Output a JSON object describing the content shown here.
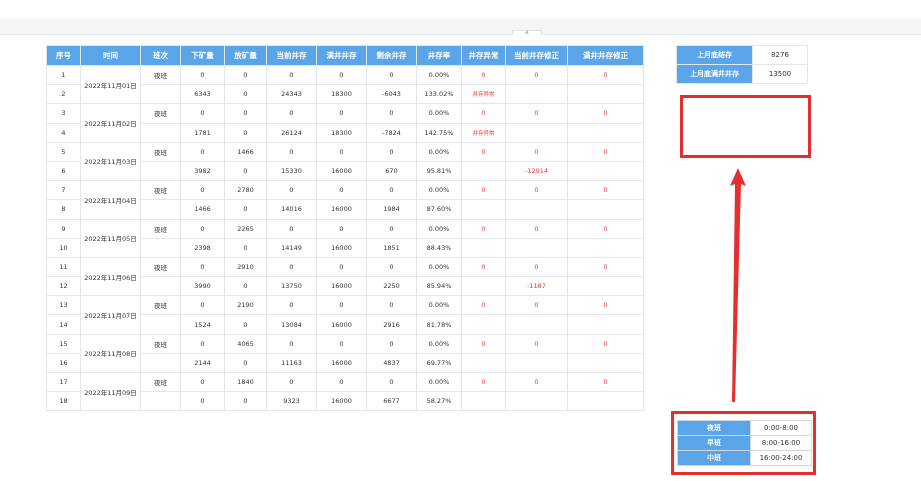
{
  "headers": [
    "序号",
    "时间",
    "班次",
    "下矿量",
    "放矿量",
    "当前井存",
    "满井井存",
    "剩余井存",
    "井存率",
    "井存异常",
    "当前井存修正",
    "满井井存修正"
  ],
  "days": [
    {
      "date": "2022年11月01日",
      "rows": [
        [
          "1",
          "夜班",
          "0",
          "0",
          "0",
          "0",
          "0",
          "0.00%",
          "0",
          "0",
          "0"
        ],
        [
          "2",
          "",
          "6343",
          "0",
          "24343",
          "18300",
          "-6043",
          "133.02%",
          "井存异常",
          "",
          ""
        ]
      ]
    },
    {
      "date": "2022年11月02日",
      "rows": [
        [
          "3",
          "夜班",
          "0",
          "0",
          "0",
          "0",
          "0",
          "0.00%",
          "0",
          "0",
          "0"
        ],
        [
          "4",
          "",
          "1781",
          "0",
          "26124",
          "18300",
          "-7824",
          "142.75%",
          "井存异常",
          "",
          ""
        ]
      ]
    },
    {
      "date": "2022年11月03日",
      "rows": [
        [
          "5",
          "夜班",
          "0",
          "1466",
          "0",
          "0",
          "0",
          "0.00%",
          "0",
          "0",
          "0"
        ],
        [
          "6",
          "",
          "3982",
          "0",
          "15330",
          "16000",
          "670",
          "95.81%",
          "",
          "-12914",
          ""
        ]
      ]
    },
    {
      "date": "2022年11月04日",
      "rows": [
        [
          "7",
          "夜班",
          "0",
          "2780",
          "0",
          "0",
          "0",
          "0.00%",
          "0",
          "0",
          "0"
        ],
        [
          "8",
          "",
          "1466",
          "0",
          "14016",
          "16000",
          "1984",
          "87.60%",
          "",
          "",
          ""
        ]
      ]
    },
    {
      "date": "2022年11月05日",
      "rows": [
        [
          "9",
          "夜班",
          "0",
          "2265",
          "0",
          "0",
          "0",
          "0.00%",
          "0",
          "0",
          "0"
        ],
        [
          "10",
          "",
          "2398",
          "0",
          "14149",
          "16000",
          "1851",
          "88.43%",
          "",
          "",
          ""
        ]
      ]
    },
    {
      "date": "2022年11月06日",
      "rows": [
        [
          "11",
          "夜班",
          "0",
          "2910",
          "0",
          "0",
          "0",
          "0.00%",
          "0",
          "0",
          "0"
        ],
        [
          "12",
          "",
          "3990",
          "0",
          "13750",
          "16000",
          "2250",
          "85.94%",
          "",
          "-1187",
          ""
        ]
      ]
    },
    {
      "date": "2022年11月07日",
      "rows": [
        [
          "13",
          "夜班",
          "0",
          "2190",
          "0",
          "0",
          "0",
          "0.00%",
          "0",
          "0",
          "0"
        ],
        [
          "14",
          "",
          "1524",
          "0",
          "13084",
          "16000",
          "2916",
          "81.78%",
          "",
          "",
          ""
        ]
      ]
    },
    {
      "date": "2022年11月08日",
      "rows": [
        [
          "15",
          "夜班",
          "0",
          "4065",
          "0",
          "0",
          "0",
          "0.00%",
          "0",
          "0",
          "0"
        ],
        [
          "16",
          "",
          "2144",
          "0",
          "11163",
          "16000",
          "4837",
          "69.77%",
          "",
          "",
          ""
        ]
      ]
    },
    {
      "date": "2022年11月09日",
      "rows": [
        [
          "17",
          "夜班",
          "0",
          "1840",
          "0",
          "0",
          "0",
          "0.00%",
          "0",
          "0",
          "0"
        ],
        [
          "18",
          "",
          "0",
          "0",
          "9323",
          "16000",
          "6677",
          "58.27%",
          "",
          "",
          ""
        ]
      ]
    }
  ],
  "stock": {
    "last_month_end_label": "上月底结存",
    "last_month_end_value": "8276",
    "last_month_full_label": "上月底满井井存",
    "last_month_full_value": "13500"
  },
  "shifts": [
    {
      "name": "夜班",
      "time": "0:00-8:00"
    },
    {
      "name": "早班",
      "time": "8:00-16:00"
    },
    {
      "name": "中班",
      "time": "16:00-24:00"
    }
  ],
  "colors": {
    "header_blue": "#5aa4e8",
    "annotation_red": "#e3302f",
    "value_red": "#e53935"
  }
}
